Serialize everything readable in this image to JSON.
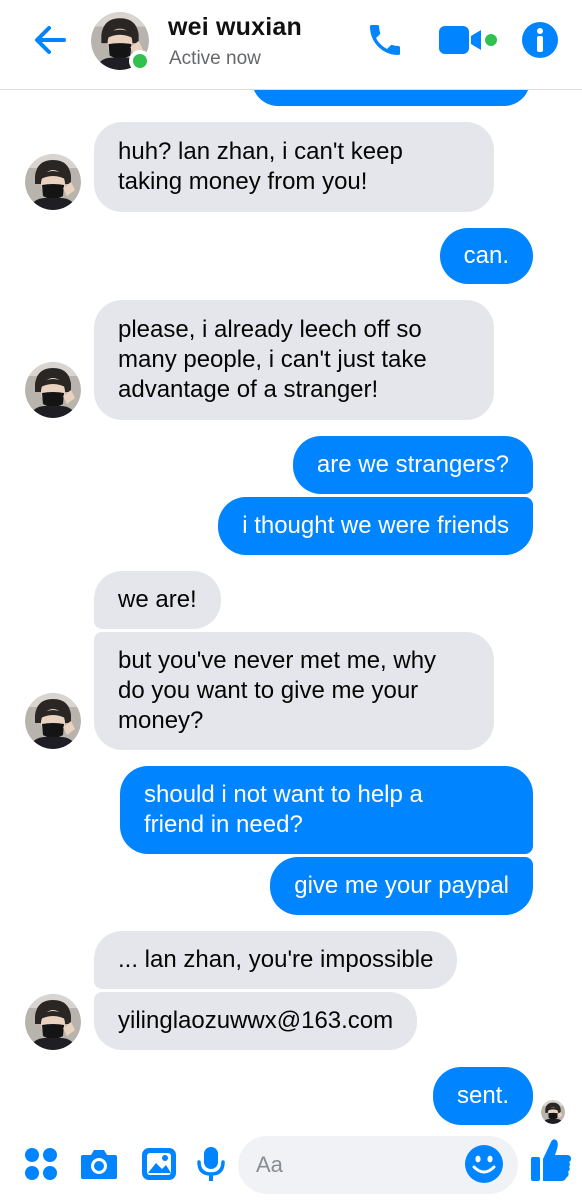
{
  "header": {
    "contact_name": "wei wuxian",
    "status": "Active now"
  },
  "colors": {
    "accent": "#0084ff",
    "incoming_bubble": "#e4e6eb",
    "online": "#31c24d",
    "text_secondary": "#65676b"
  },
  "messages": [
    {
      "from": "me",
      "text": ""
    },
    {
      "from": "them",
      "lines": [
        "huh? lan zhan, i can't keep",
        "taking money from you!"
      ]
    },
    {
      "from": "me",
      "lines": [
        "can."
      ]
    },
    {
      "from": "them",
      "lines": [
        "please, i already leech off so",
        "many people, i can't just take",
        "advantage of a stranger!"
      ]
    },
    {
      "from": "me",
      "lines": [
        "are we strangers?"
      ]
    },
    {
      "from": "me",
      "lines": [
        "i thought we were friends"
      ]
    },
    {
      "from": "them",
      "lines": [
        "we are!"
      ]
    },
    {
      "from": "them",
      "lines": [
        "but you've never met me, why",
        "do you want to give me your",
        "money?"
      ]
    },
    {
      "from": "me",
      "lines": [
        "should i not want to help a",
        "friend in need?"
      ]
    },
    {
      "from": "me",
      "lines": [
        "give me your paypal"
      ]
    },
    {
      "from": "them",
      "lines": [
        "... lan zhan, you're impossible"
      ]
    },
    {
      "from": "them",
      "lines": [
        "yilinglaozuwwx@163.com"
      ]
    },
    {
      "from": "me",
      "lines": [
        "sent."
      ]
    }
  ],
  "composer": {
    "placeholder": "Aa",
    "icons": [
      "menu-dots-icon",
      "camera-icon",
      "gallery-icon",
      "microphone-icon",
      "emoji-icon",
      "thumbs-up-icon"
    ]
  }
}
